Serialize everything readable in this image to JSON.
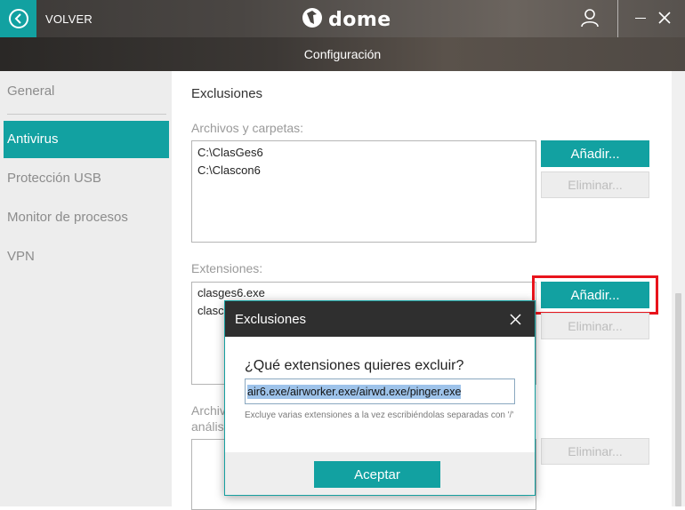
{
  "topbar": {
    "back_label": "VOLVER",
    "brand_name": "dome",
    "icons": [
      "back-icon",
      "brand-logo-icon",
      "user-icon",
      "minimize-icon",
      "close-icon"
    ]
  },
  "window_title": "Configuración",
  "sidebar": {
    "items": [
      {
        "label": "General",
        "active": false
      },
      {
        "label": "Antivirus",
        "active": true
      },
      {
        "label": "Protección USB",
        "active": false
      },
      {
        "label": "Monitor de procesos",
        "active": false
      },
      {
        "label": "VPN",
        "active": false
      }
    ]
  },
  "main": {
    "section_title": "Exclusiones",
    "files": {
      "label": "Archivos y carpetas:",
      "entries": [
        "C:\\ClasGes6",
        "C:\\Clascon6"
      ],
      "add_label": "Añadir...",
      "remove_label": "Eliminar..."
    },
    "extensions": {
      "label": "Extensiones:",
      "entries": [
        "clasges6.exe",
        "clasc"
      ],
      "add_label": "Añadir...",
      "remove_label": "Eliminar..."
    },
    "third": {
      "label_line1": "Archiv",
      "label_line2": "anális",
      "remove_label": "Eliminar..."
    }
  },
  "dialog": {
    "title": "Exclusiones",
    "question": "¿Qué extensiones quieres excluir?",
    "input_value": "air6.exe/airworker.exe/airwd.exe/pinger.exe",
    "hint": "Excluye varias extensiones a la vez escribiéndolas separadas con '/'",
    "accept_label": "Aceptar"
  },
  "colors": {
    "accent": "#12a1a1",
    "highlight": "#e8141c",
    "dialog_header": "#2f2f2f"
  }
}
